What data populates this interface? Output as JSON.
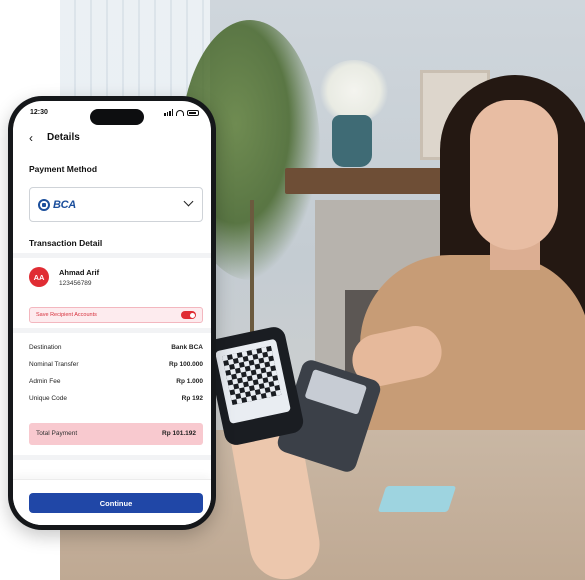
{
  "status_bar": {
    "time": "12:30"
  },
  "header": {
    "back_icon": "chevron-left-icon",
    "title": "Details"
  },
  "payment_method": {
    "section_title": "Payment Method",
    "selected_bank": "BCA",
    "dropdown_icon": "chevron-down-icon"
  },
  "transaction": {
    "section_title": "Transaction Detail",
    "recipient": {
      "initials": "AA",
      "name": "Ahmad Arif",
      "account": "123456789"
    },
    "save_recipient": {
      "label": "Save Recipient Accounts",
      "enabled": true
    },
    "rows": [
      {
        "label": "Destination",
        "value": "Bank BCA"
      },
      {
        "label": "Nominal Transfer",
        "value": "Rp 100.000"
      },
      {
        "label": "Admin Fee",
        "value": "Rp 1.000"
      },
      {
        "label": "Unique Code",
        "value": "Rp 192"
      }
    ],
    "total": {
      "label": "Total Payment",
      "value": "Rp 101.192"
    }
  },
  "footer": {
    "continue_label": "Continue"
  },
  "colors": {
    "primary": "#2047a7",
    "danger": "#e02c33",
    "bca_blue": "#1c4f9c",
    "total_bg": "#f8c9cf"
  }
}
